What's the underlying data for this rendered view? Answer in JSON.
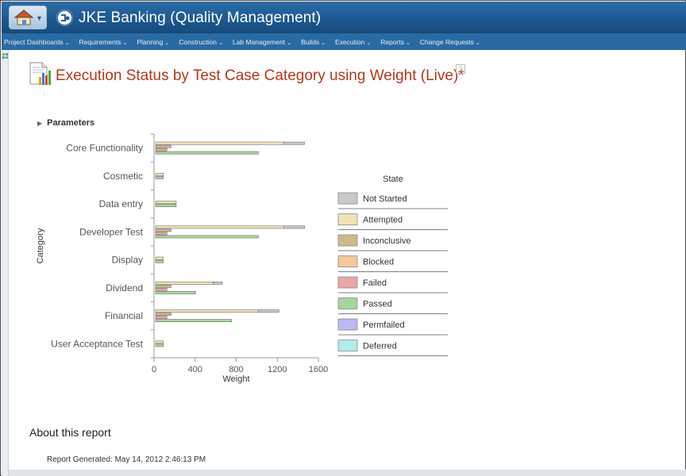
{
  "app": {
    "title": "JKE Banking (Quality Management)"
  },
  "menu": [
    {
      "label": "Project Dashboards"
    },
    {
      "label": "Requirements"
    },
    {
      "label": "Planning"
    },
    {
      "label": "Construction"
    },
    {
      "label": "Lab Management"
    },
    {
      "label": "Builds"
    },
    {
      "label": "Execution"
    },
    {
      "label": "Reports"
    },
    {
      "label": "Change Requests"
    }
  ],
  "report": {
    "title": "Execution Status by Test Case Category using Weight (Live)*",
    "help": "?",
    "parameters_label": "Parameters",
    "about_title": "About this report",
    "generated": "Report Generated: May 14, 2012 2:46:13 PM"
  },
  "colors": {
    "Not Started": "#c9c9c9",
    "Attempted": "#efe3b6",
    "Inconclusive": "#cfb98d",
    "Blocked": "#f6c89a",
    "Failed": "#e9a7a7",
    "Passed": "#a4d79b",
    "Permfailed": "#babaf0",
    "Deferred": "#b0ecec",
    "title": "#b2381b",
    "titlebar": "#1e5a93",
    "menubar": "#2a6aa4"
  },
  "chart_data": {
    "type": "bar",
    "orientation": "horizontal",
    "stacked_bars_per_category": 3,
    "xlabel": "Weight",
    "ylabel": "Category",
    "xlim": [
      0,
      1600
    ],
    "xticks": [
      0,
      400,
      800,
      1200,
      1600
    ],
    "legend_title": "State",
    "legend_position": "right",
    "categories": [
      "Core Functionality",
      "Cosmetic",
      "Data entry",
      "Developer Test",
      "Display",
      "Dividend",
      "Financial",
      "User Acceptance Test"
    ],
    "bars": [
      {
        "category": "Core Functionality",
        "segments": [
          [
            {
              "state": "Attempted",
              "value": 1250
            },
            {
              "state": "Not Started",
              "value": 200
            }
          ],
          [
            {
              "state": "Inconclusive",
              "value": 150
            }
          ],
          [
            {
              "state": "Failed",
              "value": 110
            }
          ],
          [
            {
              "state": "Passed",
              "value": 1000
            }
          ]
        ]
      },
      {
        "category": "Cosmetic",
        "segments": [
          [
            {
              "state": "Attempted",
              "value": 75
            }
          ],
          [
            {
              "state": "Passed",
              "value": 75
            }
          ]
        ]
      },
      {
        "category": "Data entry",
        "segments": [
          [
            {
              "state": "Attempted",
              "value": 200
            }
          ],
          [
            {
              "state": "Passed",
              "value": 200
            }
          ]
        ]
      },
      {
        "category": "Developer Test",
        "segments": [
          [
            {
              "state": "Attempted",
              "value": 1250
            },
            {
              "state": "Not Started",
              "value": 200
            }
          ],
          [
            {
              "state": "Inconclusive",
              "value": 150
            }
          ],
          [
            {
              "state": "Failed",
              "value": 110
            }
          ],
          [
            {
              "state": "Passed",
              "value": 1000
            }
          ]
        ]
      },
      {
        "category": "Display",
        "segments": [
          [
            {
              "state": "Attempted",
              "value": 75
            }
          ],
          [
            {
              "state": "Passed",
              "value": 75
            }
          ]
        ]
      },
      {
        "category": "Dividend",
        "segments": [
          [
            {
              "state": "Attempted",
              "value": 560
            },
            {
              "state": "Not Started",
              "value": 90
            }
          ],
          [
            {
              "state": "Inconclusive",
              "value": 150
            }
          ],
          [
            {
              "state": "Failed",
              "value": 110
            }
          ],
          [
            {
              "state": "Passed",
              "value": 390
            }
          ]
        ]
      },
      {
        "category": "Financial",
        "segments": [
          [
            {
              "state": "Attempted",
              "value": 1000
            },
            {
              "state": "Not Started",
              "value": 200
            }
          ],
          [
            {
              "state": "Inconclusive",
              "value": 150
            }
          ],
          [
            {
              "state": "Failed",
              "value": 110
            }
          ],
          [
            {
              "state": "Passed",
              "value": 740
            }
          ]
        ]
      },
      {
        "category": "User Acceptance Test",
        "segments": [
          [
            {
              "state": "Attempted",
              "value": 75
            }
          ],
          [
            {
              "state": "Passed",
              "value": 75
            }
          ]
        ]
      }
    ],
    "legend": [
      "Not Started",
      "Attempted",
      "Inconclusive",
      "Blocked",
      "Failed",
      "Passed",
      "Permfailed",
      "Deferred"
    ]
  }
}
